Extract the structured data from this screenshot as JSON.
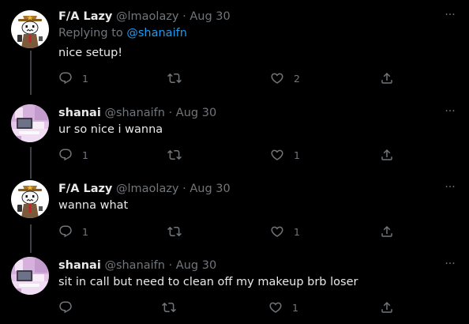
{
  "colors": {
    "background": "#000000",
    "text": "#e7e9ea",
    "muted": "#71767b",
    "link": "#1d9bf0",
    "thread_line": "#3d4145"
  },
  "tweets": [
    {
      "name": "F/A Lazy",
      "handle": "@lmaolazy",
      "separator": "·",
      "date": "Aug 30",
      "replying_label": "Replying to",
      "replying_handle": "@shanaifn",
      "text": "nice setup!",
      "avatar": "cartoon-cowboy-avatar",
      "more_label": "···",
      "reply_count": "1",
      "retweet_count": "",
      "like_count": "2"
    },
    {
      "name": "shanai",
      "handle": "@shanaifn",
      "separator": "·",
      "date": "Aug 30",
      "text": "ur so nice i wanna",
      "avatar": "pink-setup-photo-avatar",
      "more_label": "···",
      "reply_count": "1",
      "retweet_count": "",
      "like_count": "1"
    },
    {
      "name": "F/A Lazy",
      "handle": "@lmaolazy",
      "separator": "·",
      "date": "Aug 30",
      "text": "wanna what",
      "avatar": "cartoon-cowboy-avatar",
      "more_label": "···",
      "reply_count": "1",
      "retweet_count": "",
      "like_count": "1"
    },
    {
      "name": "shanai",
      "handle": "@shanaifn",
      "separator": "·",
      "date": "Aug 30",
      "text": "sit in call but need to clean off my makeup brb loser",
      "avatar": "pink-setup-photo-avatar",
      "more_label": "···",
      "reply_count": "",
      "retweet_count": "",
      "like_count": "1"
    }
  ]
}
